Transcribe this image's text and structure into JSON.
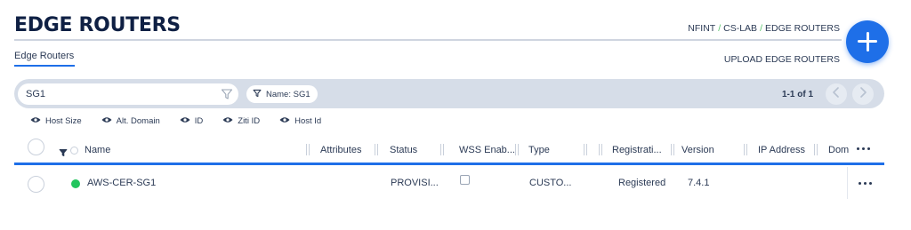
{
  "header": {
    "title": "EDGE ROUTERS",
    "breadcrumb": [
      "NFINT",
      "CS-LAB",
      "EDGE ROUTERS"
    ],
    "breadcrumb_sep": "/"
  },
  "fab": {
    "icon": "plus-icon"
  },
  "tabs": {
    "active": "Edge Routers"
  },
  "upload_label": "UPLOAD EDGE ROUTERS",
  "search": {
    "value": "SG1",
    "filter_icon": "filter-icon"
  },
  "filter_chip": {
    "label": "Name: SG1",
    "icon": "filter-icon"
  },
  "pager": {
    "text": "1-1 of 1"
  },
  "column_toggles": [
    {
      "label": "Host Size",
      "icon": "eye-icon"
    },
    {
      "label": "Alt. Domain",
      "icon": "eye-icon"
    },
    {
      "label": "ID",
      "icon": "eye-icon"
    },
    {
      "label": "Ziti ID",
      "icon": "eye-icon"
    },
    {
      "label": "Host Id",
      "icon": "eye-icon"
    }
  ],
  "table": {
    "columns": [
      "Name",
      "Attributes",
      "Status",
      "WSS Enab...",
      "Type",
      "Registrati...",
      "Version",
      "IP Address",
      "Dom"
    ],
    "rows": [
      {
        "name": "AWS-CER-SG1",
        "status_color": "#22c55e",
        "attributes": "",
        "status": "PROVISI...",
        "wss_enabled": false,
        "type": "CUSTO...",
        "registration": "Registered",
        "version": "7.4.1",
        "ip_address": "",
        "domain": ""
      }
    ]
  },
  "colors": {
    "accent": "#1e6fe8",
    "title": "#0f2044",
    "breadcrumb_separator": "#59c46b",
    "filter_bar": "#d6dde8",
    "online": "#22c55e"
  }
}
